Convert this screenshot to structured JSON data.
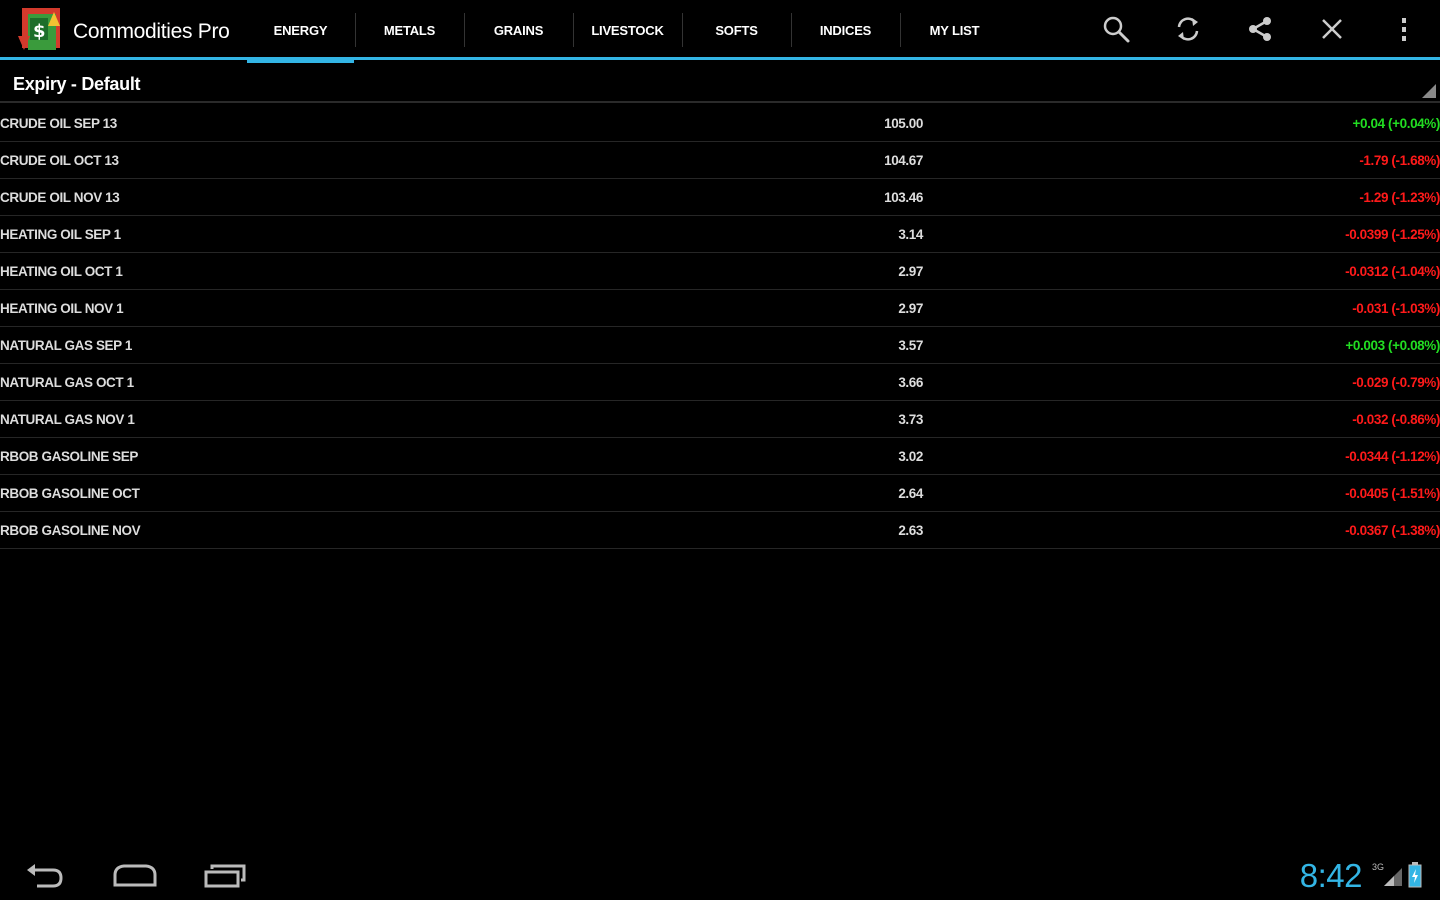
{
  "app": {
    "title": "Commodities Pro",
    "icon": "commodities-pro-logo"
  },
  "tabs": [
    {
      "label": "ENERGY",
      "active": true
    },
    {
      "label": "METALS",
      "active": false
    },
    {
      "label": "GRAINS",
      "active": false
    },
    {
      "label": "LIVESTOCK",
      "active": false
    },
    {
      "label": "SOFTS",
      "active": false
    },
    {
      "label": "INDICES",
      "active": false
    },
    {
      "label": "MY LIST",
      "active": false
    }
  ],
  "actions": [
    {
      "name": "search-icon"
    },
    {
      "name": "refresh-icon"
    },
    {
      "name": "share-icon"
    },
    {
      "name": "close-icon"
    },
    {
      "name": "overflow-menu-icon"
    }
  ],
  "expiry": {
    "label": "Expiry - Default"
  },
  "rows": [
    {
      "name": "CRUDE OIL SEP 13",
      "price": "105.00",
      "change": "+0.04 (+0.04%)",
      "direction": "up"
    },
    {
      "name": "CRUDE OIL OCT 13",
      "price": "104.67",
      "change": "-1.79 (-1.68%)",
      "direction": "down"
    },
    {
      "name": "CRUDE OIL NOV 13",
      "price": "103.46",
      "change": "-1.29 (-1.23%)",
      "direction": "down"
    },
    {
      "name": "HEATING OIL SEP 1",
      "price": "3.14",
      "change": "-0.0399 (-1.25%)",
      "direction": "down"
    },
    {
      "name": "HEATING OIL OCT 1",
      "price": "2.97",
      "change": "-0.0312 (-1.04%)",
      "direction": "down"
    },
    {
      "name": "HEATING OIL NOV 1",
      "price": "2.97",
      "change": "-0.031 (-1.03%)",
      "direction": "down"
    },
    {
      "name": "NATURAL GAS SEP 1",
      "price": "3.57",
      "change": "+0.003 (+0.08%)",
      "direction": "up"
    },
    {
      "name": "NATURAL GAS OCT 1",
      "price": "3.66",
      "change": "-0.029 (-0.79%)",
      "direction": "down"
    },
    {
      "name": "NATURAL GAS NOV 1",
      "price": "3.73",
      "change": "-0.032 (-0.86%)",
      "direction": "down"
    },
    {
      "name": "RBOB GASOLINE SEP",
      "price": "3.02",
      "change": "-0.0344 (-1.12%)",
      "direction": "down"
    },
    {
      "name": "RBOB GASOLINE OCT",
      "price": "2.64",
      "change": "-0.0405 (-1.51%)",
      "direction": "down"
    },
    {
      "name": "RBOB GASOLINE NOV",
      "price": "2.63",
      "change": "-0.0367 (-1.38%)",
      "direction": "down"
    }
  ],
  "status": {
    "time": "8:42",
    "network": "3G"
  },
  "colors": {
    "accent": "#33b5e5",
    "up": "#22dd22",
    "down": "#ff1a1a"
  }
}
